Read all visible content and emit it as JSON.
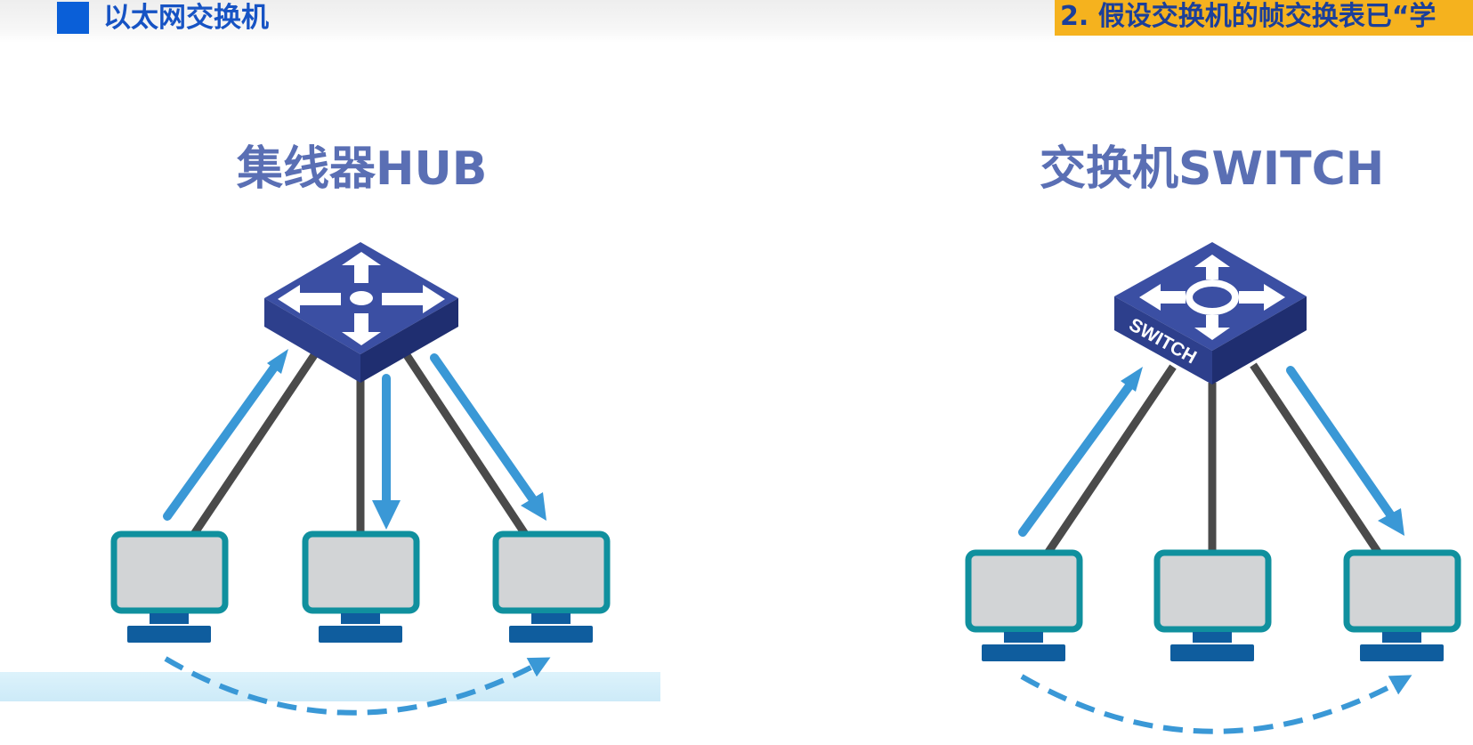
{
  "header": {
    "title": "以太网交换机",
    "accent_color": "#0a5fd8"
  },
  "step_banner": {
    "text": "2. 假设交换机的帧交换表已“学",
    "background": "#f5b21e"
  },
  "hub_panel": {
    "title": "集线器HUB",
    "device_icon": "hub-icon",
    "hosts": 3
  },
  "switch_panel": {
    "title": "交换机SWITCH",
    "device_icon": "switch-icon",
    "device_label": "SWITCH",
    "hosts": 3
  },
  "colors": {
    "device_top": "#3b4fa3",
    "device_side": "#25357c",
    "link": "#4a4a4a",
    "arrow": "#3a98d6",
    "monitor_frame": "#10909e",
    "monitor_screen": "#d2d4d6",
    "monitor_base": "#0f5d9e"
  }
}
